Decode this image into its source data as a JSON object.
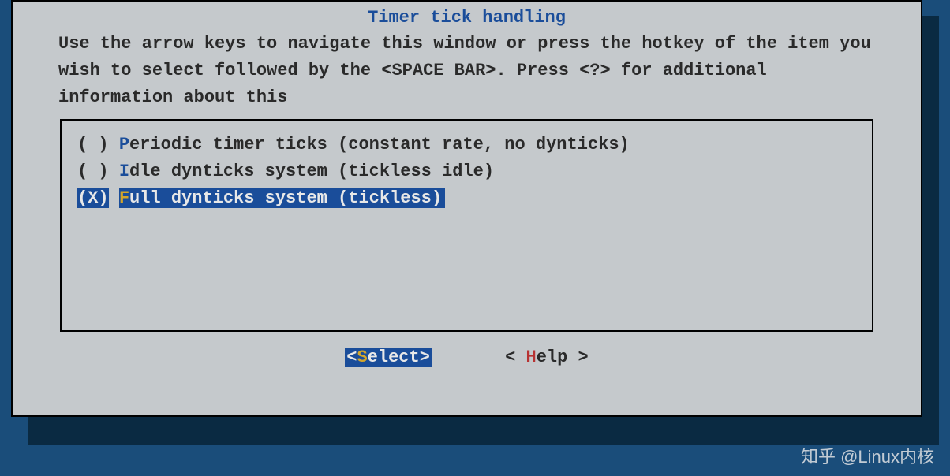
{
  "dialog": {
    "title": "Timer tick handling",
    "help_text": "Use the arrow keys to navigate this window or press the hotkey of the item you wish to select followed by the <SPACE BAR>. Press <?> for additional information about this"
  },
  "options": [
    {
      "mark": "( )",
      "hotkey": "P",
      "rest": "eriodic timer ticks (constant rate, no dynticks)",
      "selected": false
    },
    {
      "mark": "( )",
      "hotkey": "I",
      "rest": "dle dynticks system (tickless idle)",
      "selected": false
    },
    {
      "mark_open": "(",
      "mark_x": "X",
      "mark_close": ")",
      "hotkey": "F",
      "rest": "ull dynticks system (tickless)",
      "selected": true
    }
  ],
  "buttons": {
    "select": {
      "open": "<",
      "hotkey": "S",
      "rest": "elect",
      "close": ">"
    },
    "help": {
      "open": "<",
      "space": " ",
      "hotkey": "H",
      "rest": "elp",
      "space2": " ",
      "close": ">"
    }
  },
  "watermark": "知乎 @Linux内核"
}
